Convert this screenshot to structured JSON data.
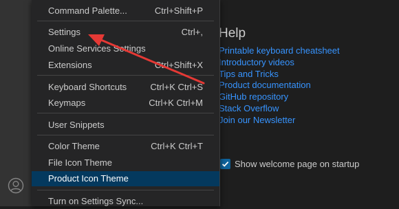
{
  "menu": {
    "items": [
      {
        "label": "Command Palette...",
        "shortcut": "Ctrl+Shift+P"
      },
      {
        "label": "Settings",
        "shortcut": "Ctrl+,"
      },
      {
        "label": "Online Services Settings",
        "shortcut": ""
      },
      {
        "label": "Extensions",
        "shortcut": "Ctrl+Shift+X"
      },
      {
        "label": "Keyboard Shortcuts",
        "shortcut": "Ctrl+K Ctrl+S"
      },
      {
        "label": "Keymaps",
        "shortcut": "Ctrl+K Ctrl+M"
      },
      {
        "label": "User Snippets",
        "shortcut": ""
      },
      {
        "label": "Color Theme",
        "shortcut": "Ctrl+K Ctrl+T"
      },
      {
        "label": "File Icon Theme",
        "shortcut": ""
      },
      {
        "label": "Product Icon Theme",
        "shortcut": ""
      },
      {
        "label": "Turn on Settings Sync...",
        "shortcut": ""
      }
    ],
    "highlighted_item": "Product Icon Theme"
  },
  "welcome": {
    "help_heading": "Help",
    "help_links": [
      "Printable keyboard cheatsheet",
      "Introductory videos",
      "Tips and Tricks",
      "Product documentation",
      "GitHub repository",
      "Stack Overflow",
      "Join our Newsletter"
    ],
    "startup_checkbox": {
      "label": "Show welcome page on startup",
      "checked": true
    }
  },
  "colors": {
    "accent": "#3794ff",
    "highlight": "#04395e",
    "annotation_arrow": "#e53935"
  },
  "icons": {
    "account": "account-icon",
    "annotation": "arrow-annotation"
  }
}
